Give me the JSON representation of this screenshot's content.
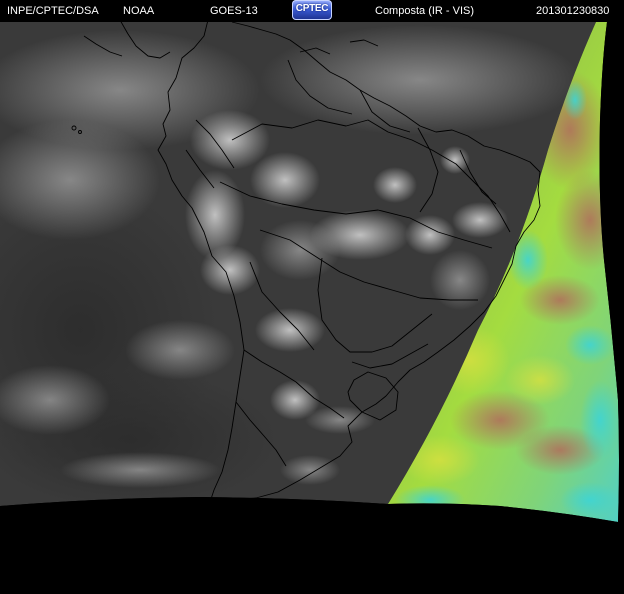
{
  "header": {
    "organization": "INPE/CPTEC/DSA",
    "agency": "NOAA",
    "satellite": "GOES-13",
    "logo_text": "CPTEC",
    "product": "Composta (IR - VIS)",
    "timestamp": "201301230830"
  },
  "colors": {
    "background": "#000000",
    "ir_cloud_base": "#3c3c3c",
    "visible_ocean_green": "#9ad63c",
    "visible_ocean_cyan": "#47d6c6",
    "visible_land_brown": "#b07a5c",
    "border_lines": "#000000"
  }
}
